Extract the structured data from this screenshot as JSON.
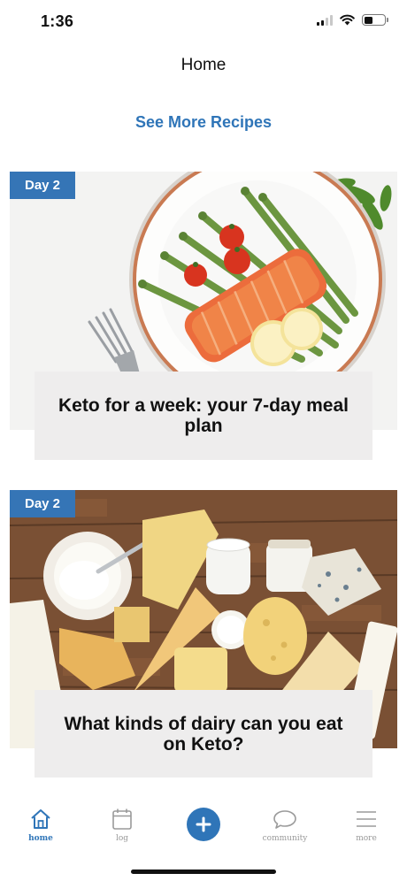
{
  "status_bar": {
    "time": "1:36"
  },
  "header": {
    "title": "Home",
    "see_more_label": "See More Recipes"
  },
  "cards": [
    {
      "badge": "Day 2",
      "title": "Keto for a week: your 7-day meal plan",
      "image_icon": "salmon-asparagus-plate"
    },
    {
      "badge": "Day 2",
      "title": "What kinds of dairy can you eat on Keto?",
      "image_icon": "cheese-dairy-board"
    }
  ],
  "tab_bar": {
    "tabs": [
      {
        "label": "home",
        "icon": "home-icon",
        "active": true
      },
      {
        "label": "log",
        "icon": "calendar-icon",
        "active": false
      },
      {
        "label": "community",
        "icon": "chat-bubble-icon",
        "active": false
      },
      {
        "label": "more",
        "icon": "menu-lines-icon",
        "active": false
      }
    ],
    "add_button_icon": "plus-icon"
  },
  "colors": {
    "accent": "#2f75b8",
    "badge": "#3575b6",
    "caption_bg": "#eeeded"
  }
}
